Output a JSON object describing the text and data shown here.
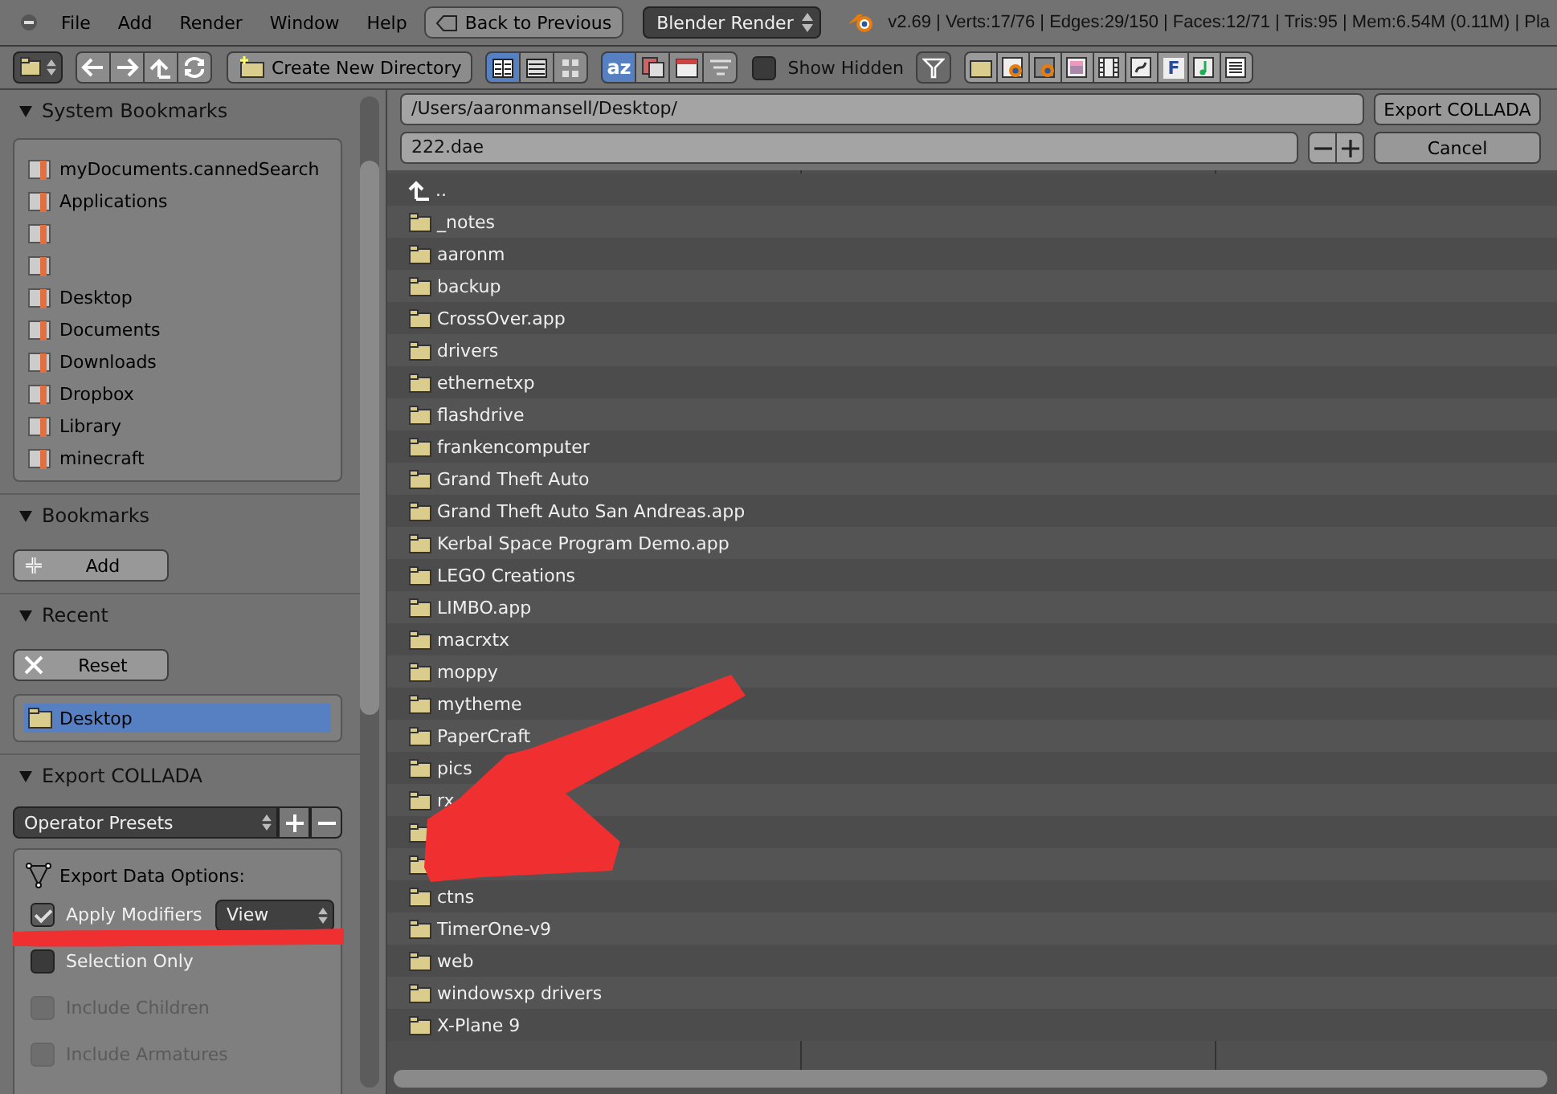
{
  "menu_bar": {
    "menus": [
      "File",
      "Add",
      "Render",
      "Window",
      "Help"
    ],
    "back_button": "Back to Previous",
    "render_engine": "Blender Render",
    "stats": "v2.69 | Verts:17/76 | Edges:29/150 | Faces:12/71 | Tris:95 | Mem:6.54M (0.11M) | Pla"
  },
  "toolbar": {
    "create_directory": "Create New Directory",
    "display_modes": [
      {
        "kind": "short",
        "selected": true
      },
      {
        "kind": "long",
        "selected": false
      },
      {
        "kind": "thumbnails",
        "selected": false
      }
    ],
    "sort_modes": [
      {
        "kind": "alpha",
        "label": "az",
        "selected": true
      },
      {
        "kind": "extension",
        "selected": false
      },
      {
        "kind": "time",
        "selected": false
      },
      {
        "kind": "size",
        "selected": false
      }
    ],
    "show_hidden": {
      "label": "Show Hidden",
      "checked": false
    },
    "filters": [
      {
        "kind": "folder"
      },
      {
        "kind": "blend"
      },
      {
        "kind": "backup"
      },
      {
        "kind": "image"
      },
      {
        "kind": "movie"
      },
      {
        "kind": "script"
      },
      {
        "kind": "font",
        "label": "F"
      },
      {
        "kind": "sound"
      },
      {
        "kind": "text"
      }
    ]
  },
  "sidebar": {
    "system_bookmarks": {
      "title": "System Bookmarks",
      "expanded": true,
      "items": [
        {
          "kind": "bookmark",
          "label": "myDocuments.cannedSearch"
        },
        {
          "kind": "bookmark",
          "label": "Applications"
        },
        {
          "kind": "bookmark"
        },
        {
          "kind": "bookmark"
        },
        {
          "kind": "bookmark",
          "label": "Desktop"
        },
        {
          "kind": "bookmark",
          "label": "Documents"
        },
        {
          "kind": "bookmark",
          "label": "Downloads"
        },
        {
          "kind": "bookmark",
          "label": "Dropbox"
        },
        {
          "kind": "bookmark",
          "label": "Library"
        },
        {
          "kind": "bookmark",
          "label": "minecraft"
        }
      ]
    },
    "bookmarks": {
      "title": "Bookmarks",
      "expanded": true,
      "button": "Add"
    },
    "recent": {
      "title": "Recent",
      "expanded": true,
      "button": "Reset",
      "items": [
        {
          "label": "Desktop",
          "selected": true
        }
      ]
    },
    "export": {
      "title": "Export COLLADA",
      "expanded": true,
      "presets": "Operator Presets",
      "section_label": "Export Data Options:",
      "options": [
        {
          "label": "Apply Modifiers",
          "checked": true,
          "disabled": false,
          "dropdown": "View"
        },
        {
          "label": "Selection Only",
          "checked": false,
          "disabled": false
        },
        {
          "label": "Include Children",
          "checked": false,
          "disabled": true
        },
        {
          "label": "Include Armatures",
          "checked": false,
          "disabled": true
        }
      ]
    }
  },
  "file_browser": {
    "directory": "/Users/aaronmansell/Desktop/",
    "filename": "222.dae",
    "export_button": "Export COLLADA",
    "cancel_button": "Cancel",
    "files": [
      {
        "kind": "parent",
        "name": ".."
      },
      {
        "kind": "folder",
        "name": "_notes"
      },
      {
        "kind": "folder",
        "name": "aaronm"
      },
      {
        "kind": "folder",
        "name": "backup"
      },
      {
        "kind": "folder",
        "name": "CrossOver.app"
      },
      {
        "kind": "folder",
        "name": "drivers"
      },
      {
        "kind": "folder",
        "name": "ethernetxp"
      },
      {
        "kind": "folder",
        "name": "flashdrive"
      },
      {
        "kind": "folder",
        "name": "frankencomputer"
      },
      {
        "kind": "folder",
        "name": "Grand Theft Auto"
      },
      {
        "kind": "folder",
        "name": "Grand Theft Auto San Andreas.app"
      },
      {
        "kind": "folder",
        "name": "Kerbal Space Program Demo.app"
      },
      {
        "kind": "folder",
        "name": "LEGO Creations"
      },
      {
        "kind": "folder",
        "name": "LIMBO.app"
      },
      {
        "kind": "folder",
        "name": "macrxtx"
      },
      {
        "kind": "folder",
        "name": "moppy"
      },
      {
        "kind": "folder",
        "name": "mytheme"
      },
      {
        "kind": "folder",
        "name": "PaperCraft"
      },
      {
        "kind": "folder",
        "name": "pics"
      },
      {
        "kind": "folder",
        "name": "rx"
      },
      {
        "kind": "folder"
      },
      {
        "kind": "folder"
      },
      {
        "kind": "folder",
        "name": "ctns"
      },
      {
        "kind": "folder",
        "name": "TimerOne-v9"
      },
      {
        "kind": "folder",
        "name": "web"
      },
      {
        "kind": "folder",
        "name": "windowsxp drivers"
      },
      {
        "kind": "folder",
        "name": "X-Plane 9"
      }
    ]
  }
}
